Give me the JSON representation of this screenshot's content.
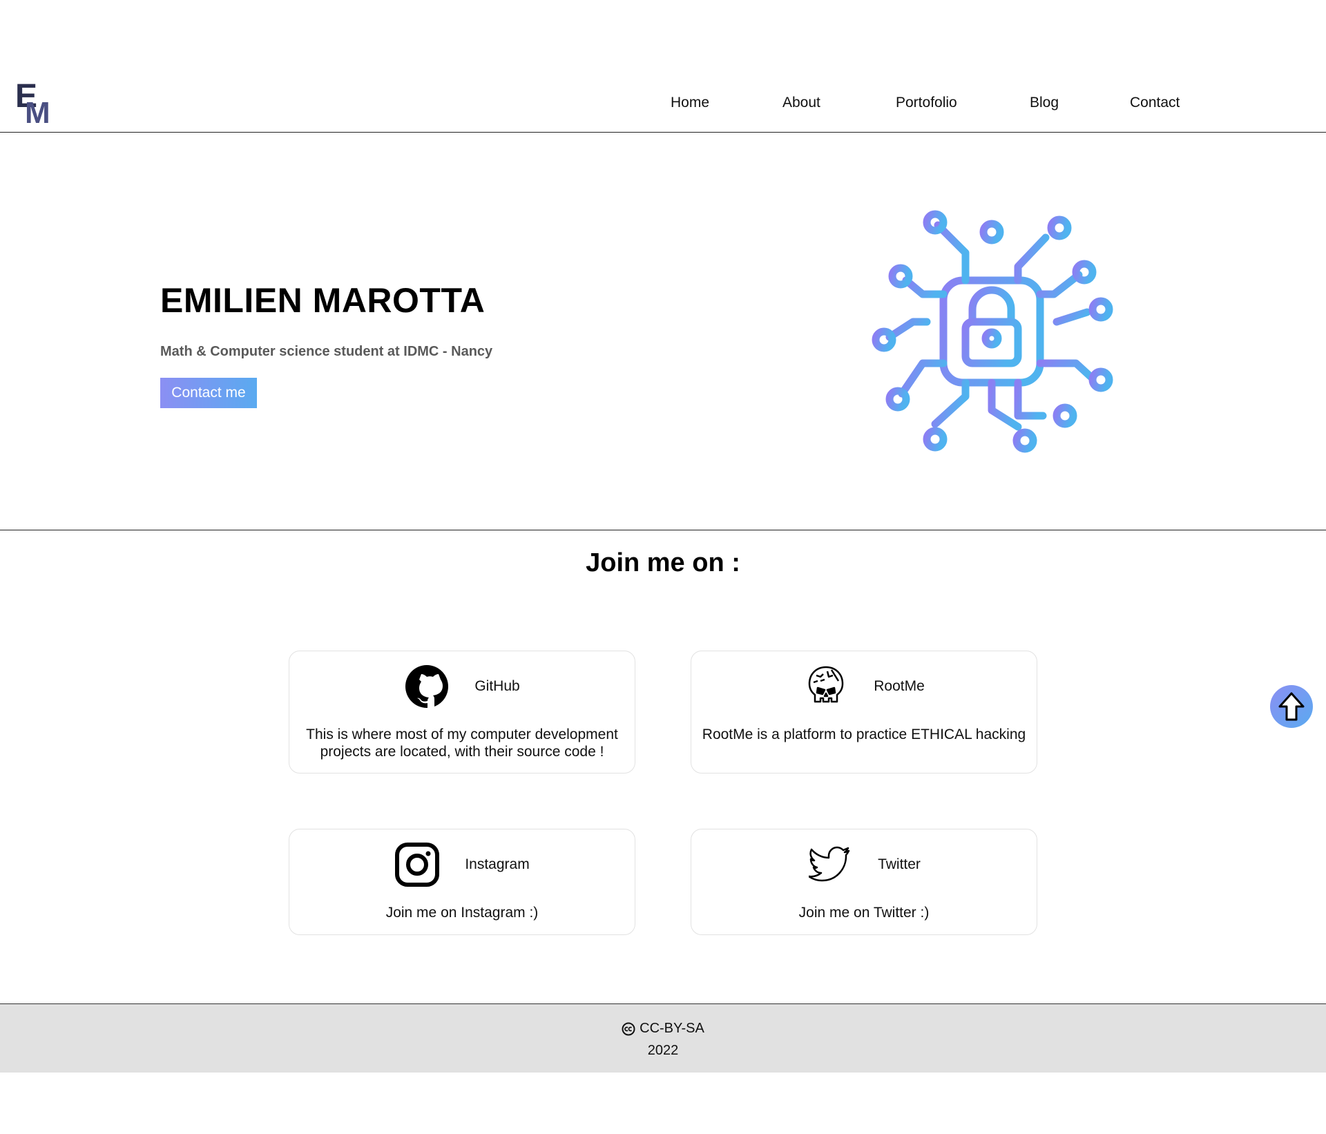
{
  "brand": {
    "logo_e": "E",
    "logo_m": "M"
  },
  "nav": {
    "items": [
      {
        "label": "Home"
      },
      {
        "label": "About"
      },
      {
        "label": "Portofolio"
      },
      {
        "label": "Blog"
      },
      {
        "label": "Contact"
      }
    ]
  },
  "hero": {
    "name": "EMILIEN MAROTTA",
    "subtitle": "Math & Computer science student at IDMC - Nancy",
    "button": "Contact me",
    "illustration_icon": "circuit-lock-icon"
  },
  "join": {
    "title": "Join me on :",
    "cards": [
      {
        "name": "GitHub",
        "icon": "github-icon",
        "description": "This is where most of my computer development projects are located, with their source code !"
      },
      {
        "name": "RootMe",
        "icon": "rootme-skull-icon",
        "description": "RootMe is a platform to practice ETHICAL hacking"
      },
      {
        "name": "Instagram",
        "icon": "instagram-icon",
        "description": "Join me on Instagram :)"
      },
      {
        "name": "Twitter",
        "icon": "twitter-bird-icon",
        "description": "Join me on Twitter :)"
      }
    ]
  },
  "scroll_top": {
    "icon": "arrow-up-icon"
  },
  "footer": {
    "license": "CC-BY-SA",
    "license_icon": "creative-commons-icon",
    "year": "2022"
  },
  "colors": {
    "accent_start": "#8b8ff3",
    "accent_end": "#5aaaf0",
    "logo_dark": "#2b2f4e",
    "logo_light": "#4a4f82",
    "footer_bg": "#e1e1e1"
  }
}
